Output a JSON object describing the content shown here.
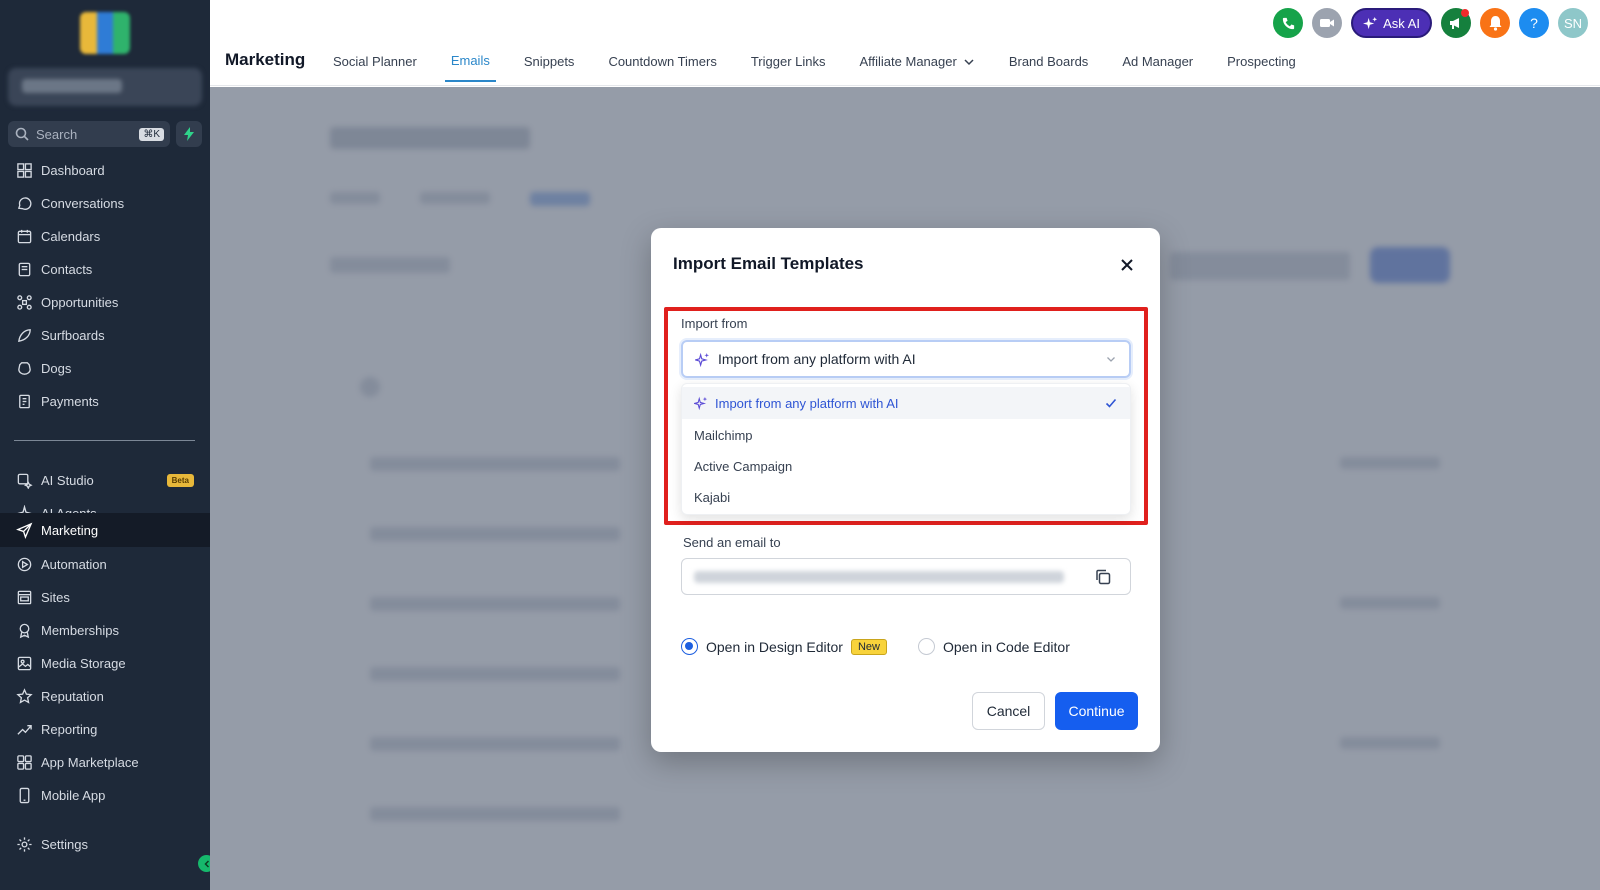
{
  "sidebar": {
    "search_placeholder": "Search",
    "search_shortcut": "⌘K",
    "items": [
      {
        "label": "Dashboard",
        "icon": "dashboard-icon"
      },
      {
        "label": "Conversations",
        "icon": "chat-icon"
      },
      {
        "label": "Calendars",
        "icon": "calendar-icon"
      },
      {
        "label": "Contacts",
        "icon": "contacts-icon"
      },
      {
        "label": "Opportunities",
        "icon": "opportunities-icon"
      },
      {
        "label": "Surfboards",
        "icon": "surfboard-icon"
      },
      {
        "label": "Dogs",
        "icon": "dog-icon"
      },
      {
        "label": "Payments",
        "icon": "payments-icon"
      },
      {
        "label": "AI Studio",
        "icon": "ai-studio-icon",
        "badge": "Beta"
      },
      {
        "label": "AI Agents",
        "icon": "ai-agents-icon"
      },
      {
        "label": "Marketing",
        "icon": "send-icon",
        "active": true
      },
      {
        "label": "Automation",
        "icon": "automation-icon"
      },
      {
        "label": "Sites",
        "icon": "sites-icon"
      },
      {
        "label": "Memberships",
        "icon": "memberships-icon"
      },
      {
        "label": "Media Storage",
        "icon": "image-icon"
      },
      {
        "label": "Reputation",
        "icon": "star-icon"
      },
      {
        "label": "Reporting",
        "icon": "trend-icon"
      },
      {
        "label": "App Marketplace",
        "icon": "grid-icon"
      },
      {
        "label": "Mobile App",
        "icon": "phone-icon"
      },
      {
        "label": "Settings",
        "icon": "gear-icon"
      }
    ]
  },
  "header": {
    "title": "Marketing",
    "tabs": [
      {
        "label": "Social Planner"
      },
      {
        "label": "Emails",
        "active": true
      },
      {
        "label": "Snippets"
      },
      {
        "label": "Countdown Timers"
      },
      {
        "label": "Trigger Links"
      },
      {
        "label": "Affiliate Manager",
        "has_chevron": true
      },
      {
        "label": "Brand Boards"
      },
      {
        "label": "Ad Manager"
      },
      {
        "label": "Prospecting"
      }
    ],
    "ask_ai_label": "Ask AI",
    "help_label": "?",
    "avatar_initials": "SN"
  },
  "modal": {
    "title": "Import Email Templates",
    "import_from_label": "Import from",
    "selected_value": "Import from any platform with AI",
    "options": [
      {
        "label": "Import from any platform with AI",
        "selected": true
      },
      {
        "label": "Mailchimp"
      },
      {
        "label": "Active Campaign"
      },
      {
        "label": "Kajabi"
      }
    ],
    "send_email_label": "Send an email to",
    "design_editor_label": "Open in Design Editor",
    "new_badge": "New",
    "code_editor_label": "Open in Code Editor",
    "cancel_label": "Cancel",
    "continue_label": "Continue"
  },
  "colors": {
    "sidebar_bg": "#1e2939",
    "accent_tab": "#2b87c9",
    "primary_button": "#155eef",
    "highlight_border": "#e0201d",
    "ask_ai": "#4c2fb5"
  }
}
